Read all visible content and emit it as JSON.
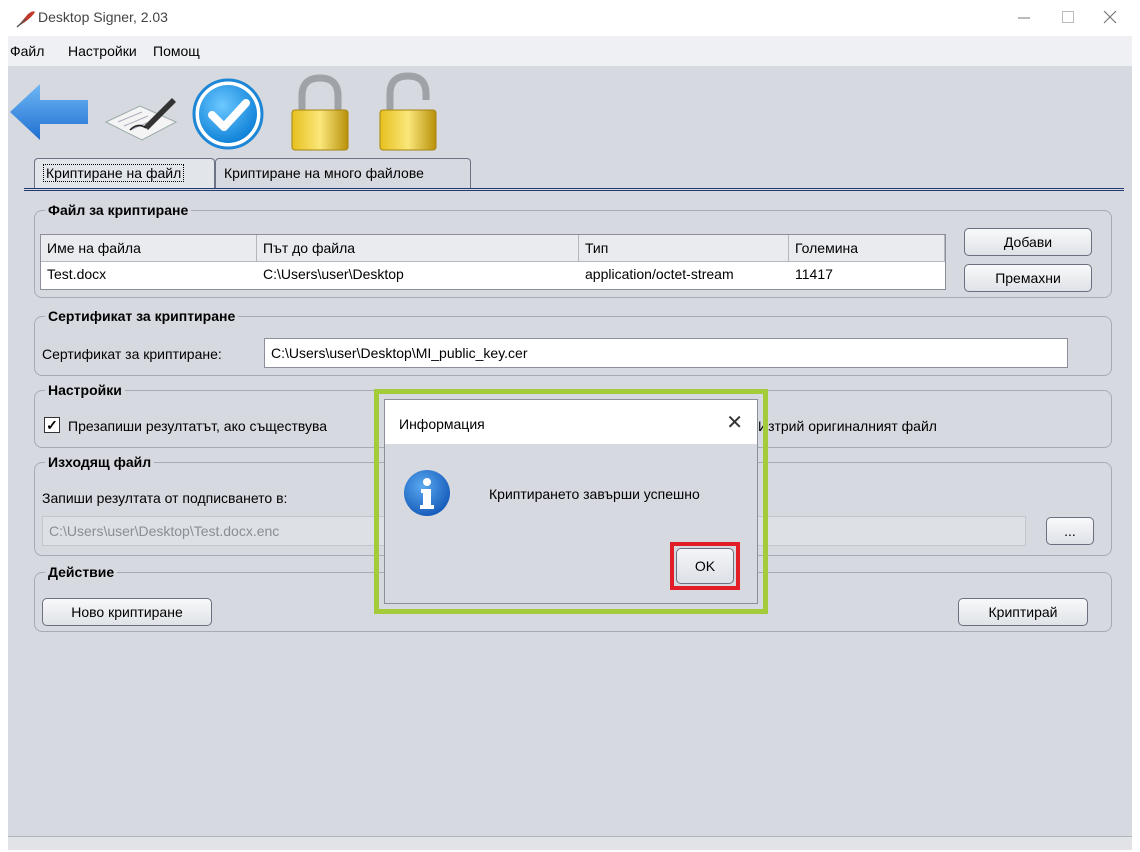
{
  "window": {
    "title": "Desktop Signer, 2.03"
  },
  "menu": [
    "Файл",
    "Настройки",
    "Помощ"
  ],
  "toolbar": {
    "icons": [
      "back-arrow-icon",
      "signature-icon",
      "checkmark-icon",
      "lock-closed-icon",
      "lock-open-icon"
    ]
  },
  "tabs": [
    "Криптиране на файл",
    "Криптиране на много файлове"
  ],
  "file_group": {
    "title": "Файл за криптиране",
    "columns": [
      "Име на файла",
      "Път до файла",
      "Тип",
      "Големина"
    ],
    "rows": [
      [
        "Test.docx",
        "C:\\Users\\user\\Desktop",
        "application/octet-stream",
        "11417"
      ]
    ],
    "add_label": "Добави",
    "remove_label": "Премахни"
  },
  "cert_group": {
    "title": "Сертификат за криптиране",
    "label": "Сертификат за криптиране:",
    "value": "C:\\Users\\user\\Desktop\\MI_public_key.cer"
  },
  "settings_group": {
    "title": "Настройки",
    "overwrite_label": "Презапиши резултатът, ако съществува",
    "overwrite_checked": "✓",
    "delete_label_partial": "Изтрий оригиналният файл"
  },
  "output_group": {
    "title": "Изходящ файл",
    "label": "Запиши резултата от подписването в:",
    "value": "C:\\Users\\user\\Desktop\\Test.docx.enc",
    "browse_label": "..."
  },
  "action_group": {
    "title": "Действие",
    "new_label": "Ново криптиране",
    "encrypt_label": "Криптирай"
  },
  "dialog": {
    "title": "Информация",
    "message": "Криптирането завърши успешно",
    "ok_label": "OK",
    "close_glyph": "✕"
  },
  "colors": {
    "highlight_green": "#a4cc3a",
    "highlight_red": "#e21d27",
    "accent_blue": "#1f8be6"
  }
}
